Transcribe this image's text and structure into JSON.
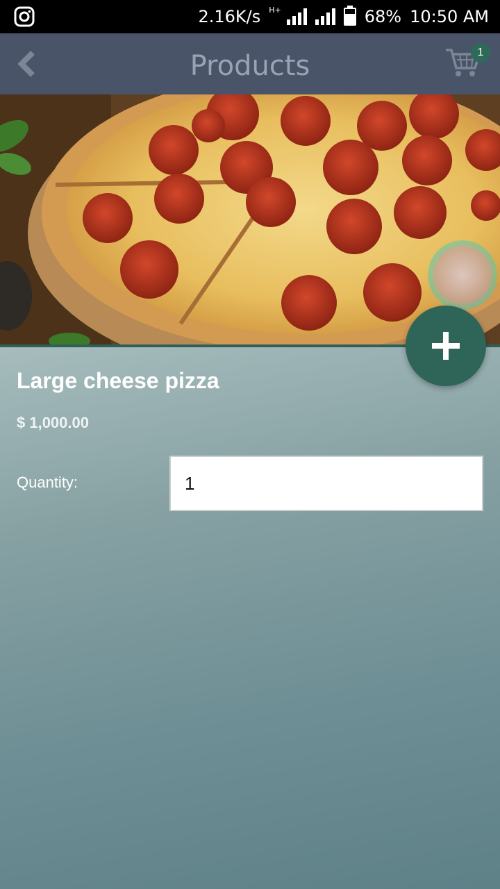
{
  "status_bar": {
    "app_icon": "instagram-icon",
    "net_speed": "2.16K/s",
    "network_type": "H+",
    "battery_percent": "68%",
    "time": "10:50 AM"
  },
  "header": {
    "title": "Products",
    "back_icon": "chevron-left-icon",
    "cart_icon": "shopping-cart-icon",
    "cart_count": "1"
  },
  "product": {
    "image_description": "pepperoni-pizza-photo",
    "name": "Large cheese pizza",
    "price": "$ 1,000.00",
    "quantity_label": "Quantity:",
    "quantity_value": "1"
  },
  "fab": {
    "icon": "plus-icon"
  },
  "colors": {
    "header_bg": "#4a5468",
    "accent": "#2f6558",
    "title_text": "#9aa3b2"
  }
}
